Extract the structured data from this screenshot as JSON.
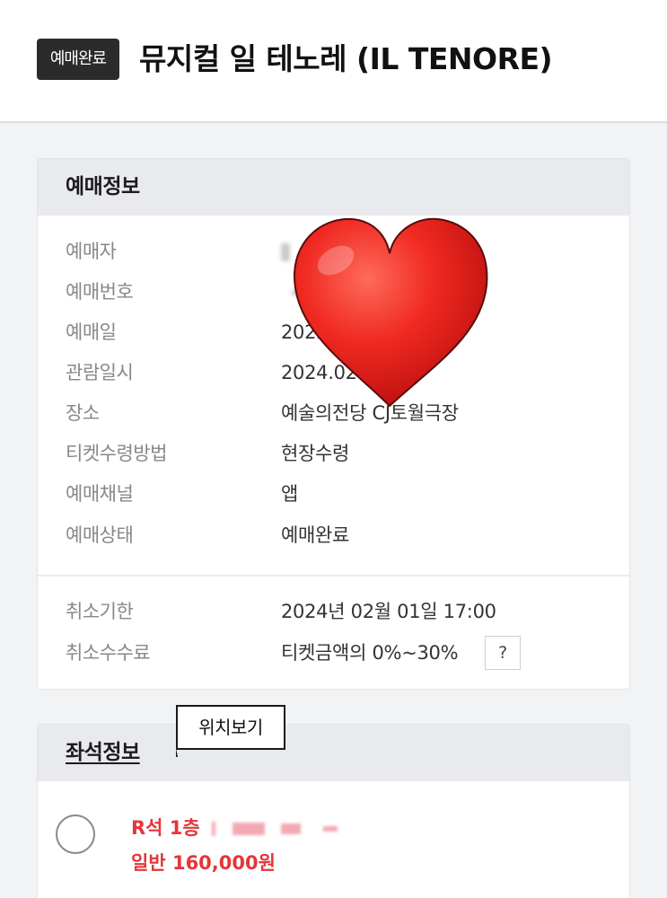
{
  "header": {
    "status_badge": "예매완료",
    "title": "뮤지컬 일 테노레 (IL TENORE)"
  },
  "booking_info": {
    "title": "예매정보",
    "rows": [
      {
        "label": "예매자",
        "value": ""
      },
      {
        "label": "예매번호",
        "value": ""
      },
      {
        "label": "예매일",
        "value": "2023."
      },
      {
        "label": "관람일시",
        "value": "2024.02"
      },
      {
        "label": "장소",
        "value": "예술의전당 CJ토월극장"
      },
      {
        "label": "티켓수령방법",
        "value": "현장수령"
      },
      {
        "label": "예매채널",
        "value": "앱"
      },
      {
        "label": "예매상태",
        "value": "예매완료"
      }
    ],
    "cancel_rows": [
      {
        "label": "취소기한",
        "value": "2024년 02월 01일 17:00"
      },
      {
        "label": "취소수수료",
        "value": "티켓금액의 0%~30%"
      }
    ],
    "help_label": "?"
  },
  "seat_info": {
    "title": "좌석정보",
    "tooltip": "위치보기",
    "seat_grade": "R석 1층",
    "seat_price": "일반 160,000원"
  },
  "colors": {
    "accent_red": "#e4363a",
    "badge_bg": "#2b2b2b",
    "heart_red": "#e8201c"
  },
  "icons": {
    "heart": "heart-sticker-icon",
    "help": "question-mark-icon",
    "radio": "radio-unchecked-icon"
  }
}
